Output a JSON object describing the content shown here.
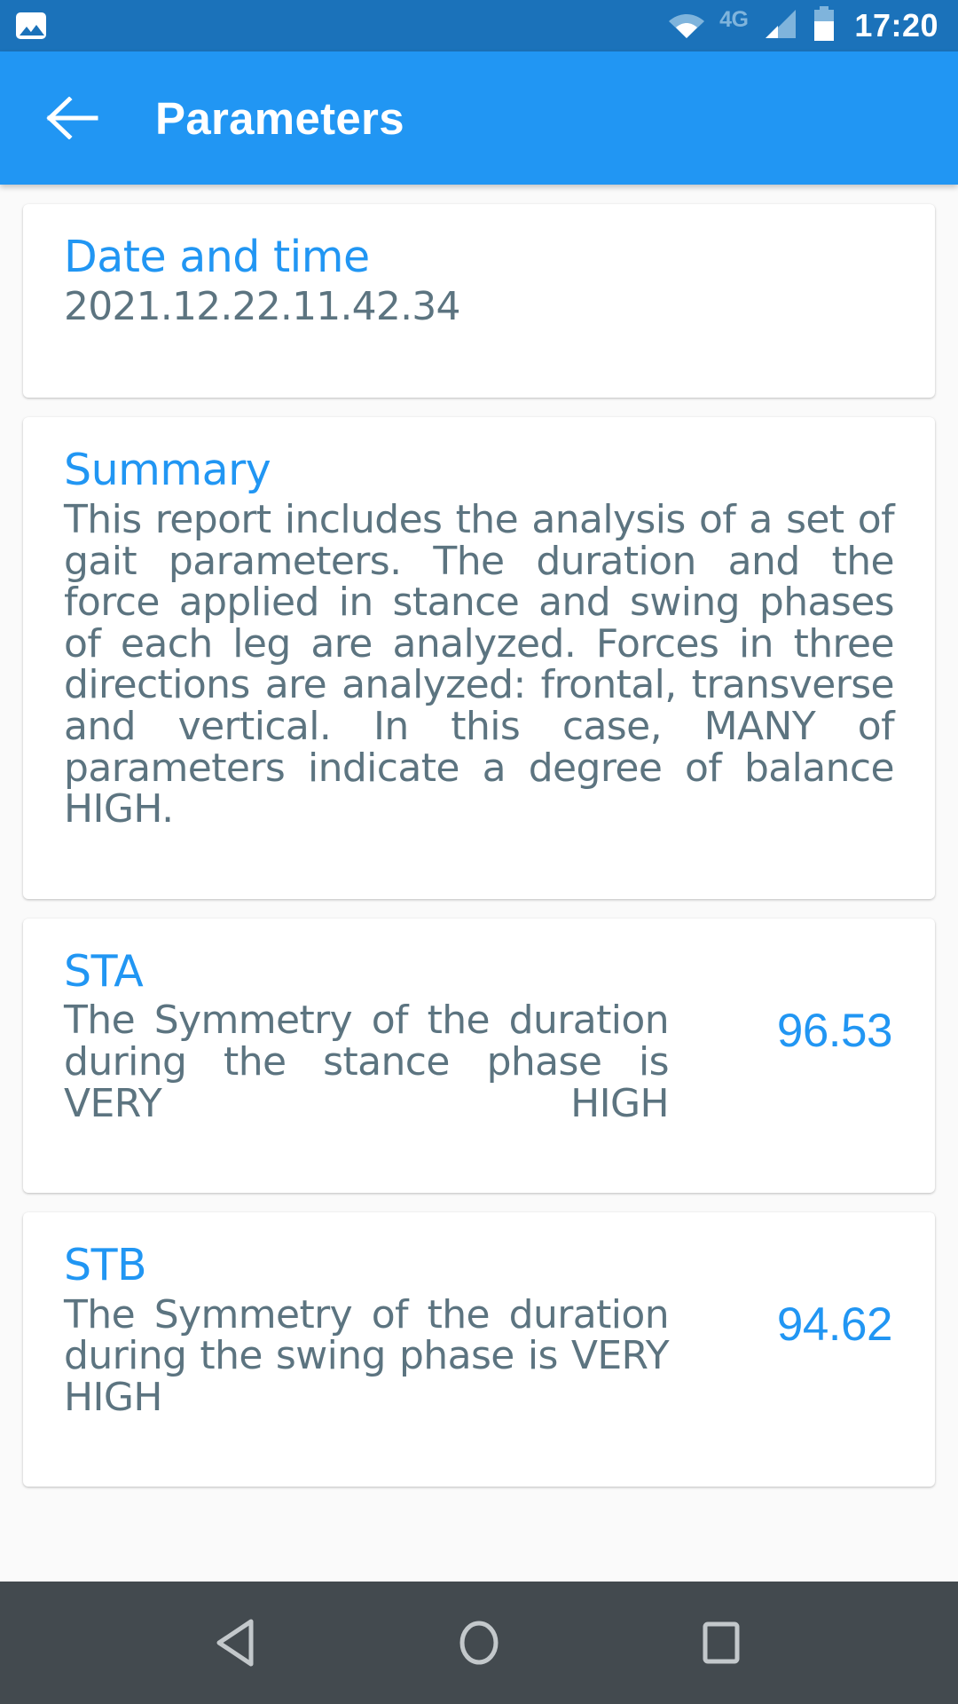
{
  "status_bar": {
    "notification_icon": "photo-icon",
    "wifi_icon": "wifi-icon",
    "network_label": "4G",
    "signal_icon": "signal-bars-icon",
    "battery_icon": "battery-icon",
    "time": "17:20",
    "background_color": "#1b72ba"
  },
  "app_bar": {
    "back_icon": "back-arrow-icon",
    "title": "Parameters",
    "background_color": "#2196f3"
  },
  "colors": {
    "accent": "#2196f3",
    "body_text": "#5c7480",
    "page_background": "#fafafa",
    "nav_background": "#434a4f"
  },
  "cards": [
    {
      "title": "Date and time",
      "body": "2021.12.22.11.42.34",
      "value": null,
      "justify": false
    },
    {
      "title": "Summary",
      "body": "This report includes the analysis of a set of gait parameters. The duration and the force applied in stance and swing phases of each leg are analyzed. Forces in three directions are analyzed: frontal, transverse and vertical. In this case, MANY of parameters indicate a degree of balance HIGH.",
      "value": null,
      "justify": true
    },
    {
      "title": "STA",
      "body": "The Symmetry of the duration during the stance phase is VERY HIGH",
      "value": "96.53",
      "justify": true
    },
    {
      "title": "STB",
      "body": "The Symmetry of the duration during the swing phase is VERY HIGH",
      "value": "94.62",
      "justify": true
    }
  ],
  "nav_bar": {
    "back_label": "back-triangle-icon",
    "home_label": "home-circle-icon",
    "recents_label": "recents-square-icon"
  }
}
